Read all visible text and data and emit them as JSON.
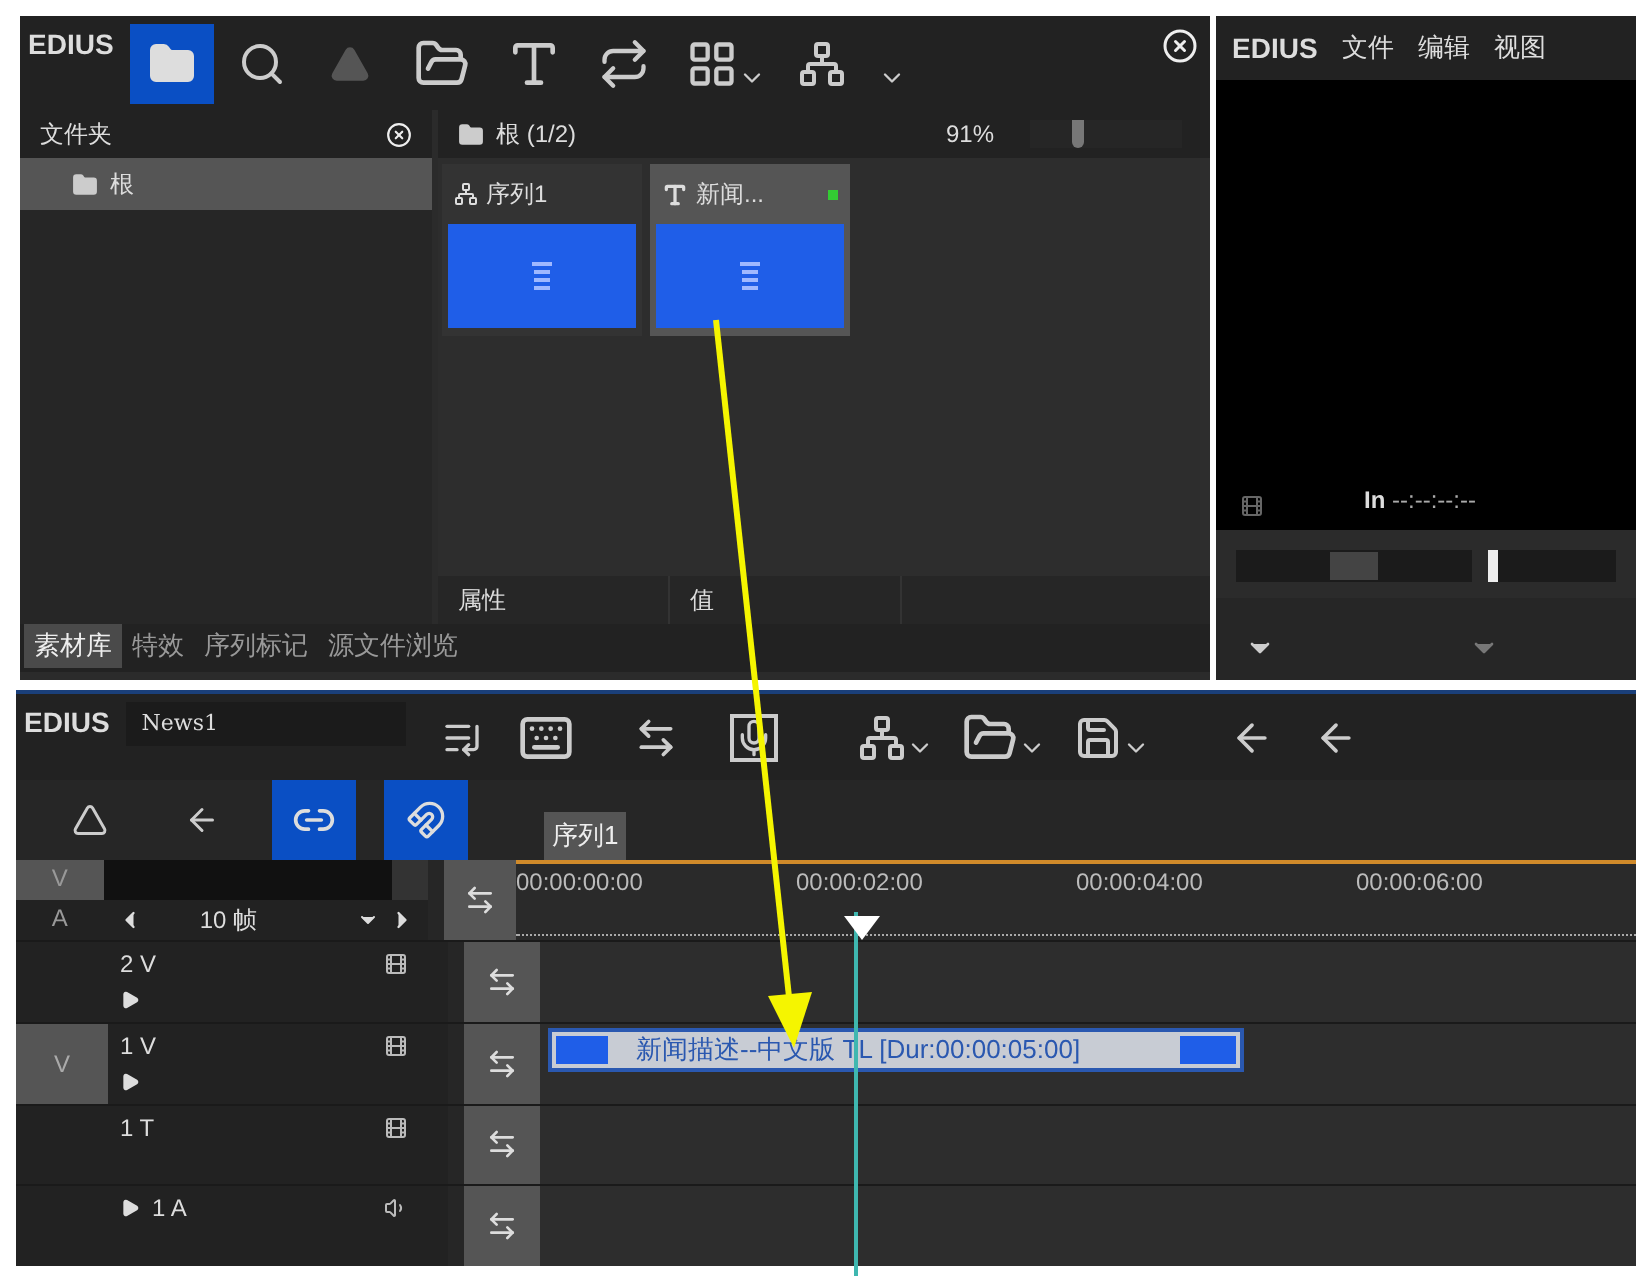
{
  "bin": {
    "app_name": "EDIUS",
    "folder_title": "文件夹",
    "folders": [
      {
        "label": "根",
        "selected": true
      }
    ],
    "path": "根 (1/2)",
    "zoom": "91%",
    "zoom_slider": {
      "level": 0.3
    },
    "clips": [
      {
        "kind": "sequence",
        "label": "序列1",
        "selected": false
      },
      {
        "kind": "title",
        "label": "新闻...",
        "selected": true
      }
    ],
    "property_columns": [
      "属性",
      "值"
    ],
    "tabs": [
      {
        "label": "素材库",
        "selected": true
      },
      {
        "label": "特效",
        "selected": false
      },
      {
        "label": "序列标记",
        "selected": false
      },
      {
        "label": "源文件浏览",
        "selected": false
      }
    ]
  },
  "player": {
    "app_name": "EDIUS",
    "menu": [
      "文件",
      "编辑",
      "视图"
    ],
    "in_label": "In",
    "in_timecode": "--:--:--:--",
    "shuttle": {
      "level": 0.5
    }
  },
  "timeline": {
    "app_name": "EDIUS",
    "project": "News1",
    "modes": [
      {
        "kind": "ripple",
        "on": false
      },
      {
        "kind": "insert",
        "on": false
      },
      {
        "kind": "link",
        "on": true
      },
      {
        "kind": "snap",
        "on": true
      }
    ],
    "sequence_tab": "序列1",
    "patch_labels": [
      "V",
      "A"
    ],
    "frames": "10 帧",
    "ruler": [
      "00:00:00:00",
      "00:00:02:00",
      "00:00:04:00",
      "00:00:06:00"
    ],
    "tracks": [
      {
        "kind": "video",
        "label": "2 V"
      },
      {
        "kind": "video",
        "label": "1 V",
        "patch": "V"
      },
      {
        "kind": "title",
        "label": "1 T"
      },
      {
        "kind": "audio",
        "label": "1 A"
      }
    ],
    "clip": {
      "title": "新闻描述--中文版",
      "info": "TL [Dur:00:00:05:00]"
    }
  }
}
